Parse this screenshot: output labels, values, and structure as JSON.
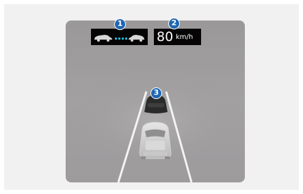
{
  "display": {
    "speed_value": "80",
    "speed_unit": "km/h"
  },
  "callouts": {
    "c1": "1",
    "c2": "2",
    "c3": "3"
  },
  "icons": {
    "distance": "distance-gap-icon",
    "lead_vehicle": "lead-vehicle-icon",
    "own_vehicle": "own-vehicle-icon"
  },
  "colors": {
    "screen_background": "#9c9a9b",
    "callout": "#1f66b3",
    "distance_dots": "#25b6d6",
    "lane_lines": "#f4f4f4"
  }
}
